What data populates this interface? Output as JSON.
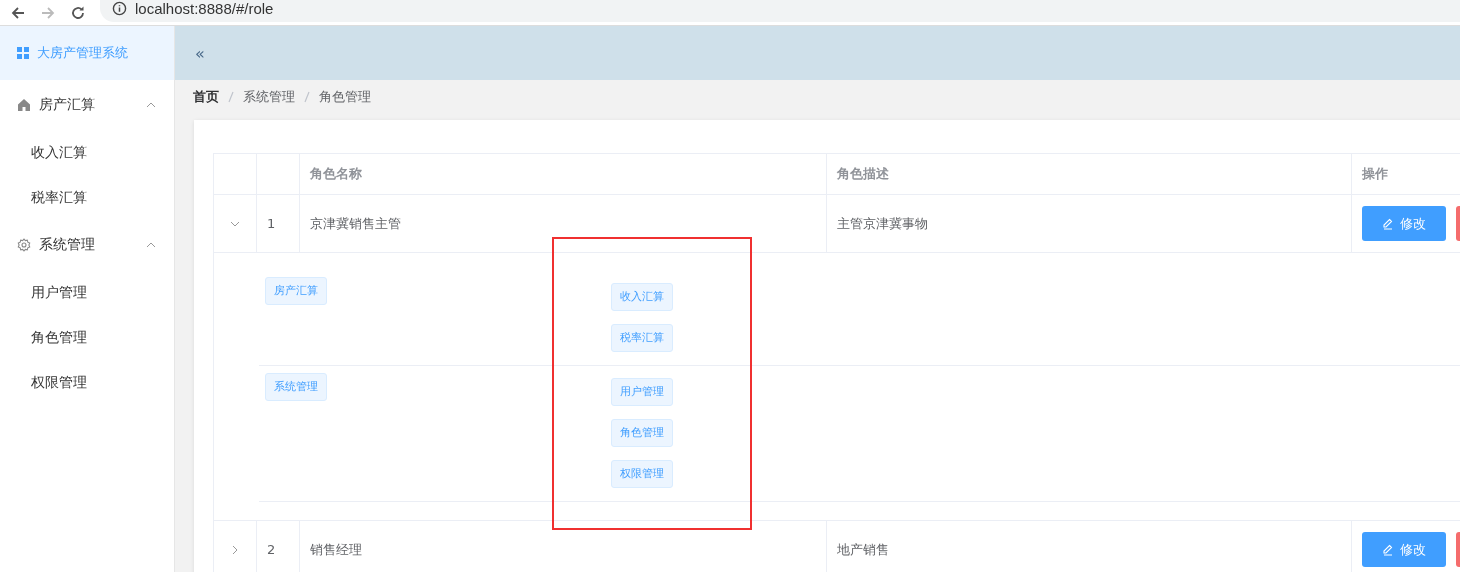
{
  "browser": {
    "url": "localhost:8888/#/role",
    "back_disabled": false,
    "forward_disabled": true
  },
  "sidebar": {
    "title": "大房产管理系统",
    "groups": [
      {
        "label": "房产汇算",
        "expanded": true,
        "children": [
          {
            "label": "收入汇算",
            "selected": false
          },
          {
            "label": "税率汇算",
            "selected": false
          }
        ]
      },
      {
        "label": "系统管理",
        "expanded": true,
        "children": [
          {
            "label": "用户管理",
            "selected": false
          },
          {
            "label": "角色管理",
            "selected": false
          },
          {
            "label": "权限管理",
            "selected": false
          }
        ]
      }
    ]
  },
  "header": {
    "collapse_icon": "«"
  },
  "breadcrumb": [
    "首页",
    "系统管理",
    "角色管理"
  ],
  "table": {
    "columns": [
      "角色名称",
      "角色描述",
      "操作"
    ],
    "rows": [
      {
        "index": "1",
        "name": "京津冀销售主管",
        "description": "主管京津冀事物",
        "expanded": true,
        "buttons": [
          {
            "kind": "edit",
            "label": "修改"
          },
          {
            "kind": "delete"
          }
        ],
        "rights": [
          {
            "label": "房产汇算",
            "children": [
              {
                "label": "收入汇算"
              },
              {
                "label": "税率汇算"
              }
            ]
          },
          {
            "label": "系统管理",
            "children": [
              {
                "label": "用户管理"
              },
              {
                "label": "角色管理"
              },
              {
                "label": "权限管理"
              }
            ]
          }
        ]
      },
      {
        "index": "2",
        "name": "销售经理",
        "description": "地产销售",
        "expanded": false,
        "buttons": [
          {
            "kind": "edit",
            "label": "修改"
          },
          {
            "kind": "delete"
          }
        ]
      }
    ]
  },
  "annotation": {
    "kind": "highlight-box"
  }
}
